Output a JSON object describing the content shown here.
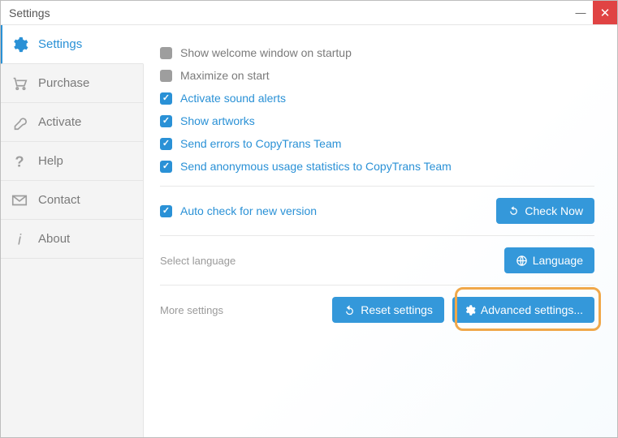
{
  "window": {
    "title": "Settings"
  },
  "sidebar": {
    "items": [
      {
        "label": "Settings"
      },
      {
        "label": "Purchase"
      },
      {
        "label": "Activate"
      },
      {
        "label": "Help"
      },
      {
        "label": "Contact"
      },
      {
        "label": "About"
      }
    ]
  },
  "checks": {
    "welcome": "Show welcome window on startup",
    "maximize": "Maximize on start",
    "sound": "Activate sound alerts",
    "artworks": "Show artworks",
    "errors": "Send errors to CopyTrans Team",
    "stats": "Send anonymous usage statistics to CopyTrans Team",
    "autocheck": "Auto check for new version"
  },
  "labels": {
    "select_language": "Select language",
    "more_settings": "More settings"
  },
  "buttons": {
    "check_now": "Check Now",
    "language": "Language",
    "reset": "Reset settings",
    "advanced": "Advanced settings..."
  }
}
